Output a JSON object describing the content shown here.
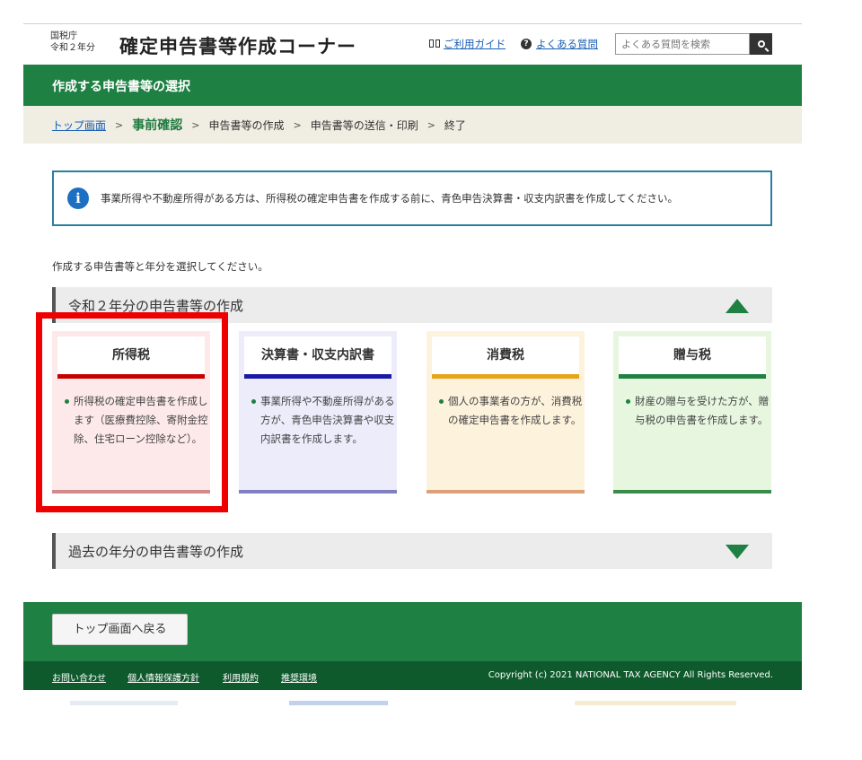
{
  "header": {
    "agency_name": "国税庁",
    "fiscal_year": "令和２年分",
    "site_title": "確定申告書等作成コーナー",
    "guide_link": "ご利用ガイド",
    "faq_link": "よくある質問",
    "search_placeholder": "よくある質問を検索"
  },
  "page_heading": "作成する申告書等の選択",
  "breadcrumb": {
    "top": "トップ画面",
    "current": "事前確認",
    "step3": "申告書等の作成",
    "step4": "申告書等の送信・印刷",
    "step5": "終了"
  },
  "notice": "事業所得や不動産所得がある方は、所得税の確定申告書を作成する前に、青色申告決算書・収支内訳書を作成してください。",
  "instruction": "作成する申告書等と年分を選択してください。",
  "section_current": "令和２年分の申告書等の作成",
  "section_past": "過去の年分の申告書等の作成",
  "cards": [
    {
      "title": "所得税",
      "desc": "所得税の確定申告書を作成します（医療費控除、寄附金控除、住宅ローン控除など）。",
      "bg": "#fde9e9",
      "accent": "#c80000",
      "bottom": "#d28b8b"
    },
    {
      "title": "決算書・収支内訳書",
      "desc": "事業所得や不動産所得がある方が、青色申告決算書や収支内訳書を作成します。",
      "bg": "#ececfb",
      "accent": "#1a1aa8",
      "bottom": "#8080c0"
    },
    {
      "title": "消費税",
      "desc": "個人の事業者の方が、消費税の確定申告書を作成します。",
      "bg": "#fdf2dc",
      "accent": "#e8a316",
      "bottom": "#d9a07a"
    },
    {
      "title": "贈与税",
      "desc": "財産の贈与を受けた方が、贈与税の申告書を作成します。",
      "bg": "#e6f6df",
      "accent": "#1e8043",
      "bottom": "#3a8a4a"
    }
  ],
  "footer": {
    "back_button": "トップ画面へ戻る",
    "links": [
      "お問い合わせ",
      "個人情報保護方針",
      "利用規約",
      "推奨環境"
    ],
    "copyright": "Copyright (c) 2021 NATIONAL TAX AGENCY All Rights Reserved."
  },
  "colors": {
    "brand_green": "#1e8043",
    "highlight": "#ee0000"
  },
  "icons": [
    "book-icon",
    "question-icon",
    "search-icon",
    "info-icon",
    "triangle-up-icon",
    "triangle-down-icon"
  ]
}
